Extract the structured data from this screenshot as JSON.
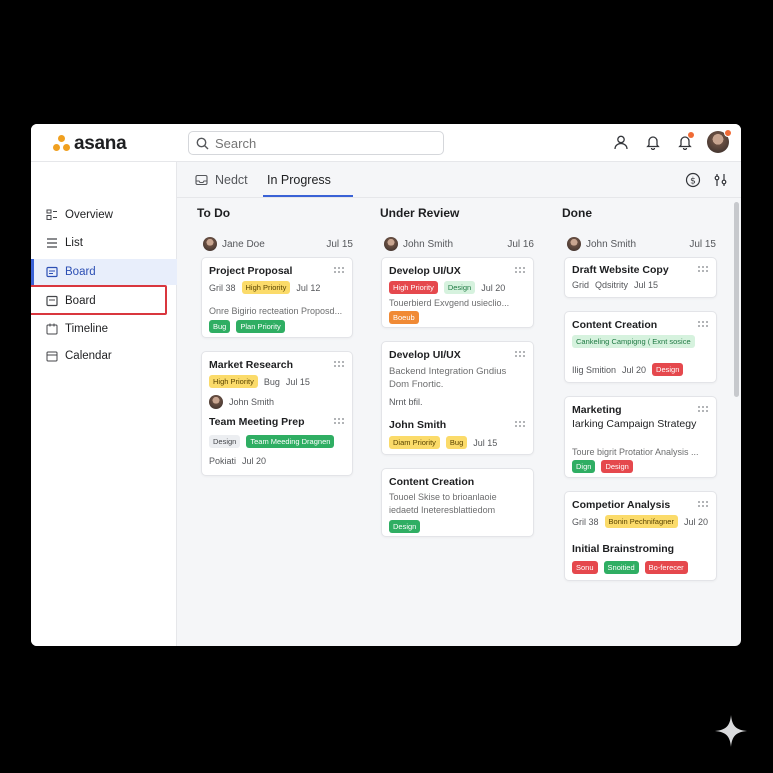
{
  "app": {
    "logo_text": "asana",
    "brand_color": "#f0a020",
    "accent_color": "#3a62d6"
  },
  "search": {
    "placeholder": "Search",
    "icon": "search-icon"
  },
  "topbar_icons": [
    "user-icon",
    "bell-icon",
    "bell-alert-icon",
    "avatar"
  ],
  "sidebar": {
    "items": [
      {
        "label": "Overview",
        "icon": "overview-icon"
      },
      {
        "label": "List",
        "icon": "list-icon"
      },
      {
        "label": "Board",
        "icon": "board-icon",
        "active": true
      },
      {
        "label": "Board",
        "icon": "board-icon",
        "highlighted": true
      },
      {
        "label": "Timeline",
        "icon": "timeline-icon"
      },
      {
        "label": "Calendar",
        "icon": "calendar-icon"
      }
    ]
  },
  "tabs": [
    {
      "label": "Nedct",
      "icon": "inbox-icon"
    },
    {
      "label": "In Progress",
      "active": true
    }
  ],
  "columns": [
    {
      "title": "To Do",
      "meta": {
        "name": "Jane Doe",
        "date": "Jul 15"
      },
      "cards": [
        {
          "title": "Project Proposal",
          "row1_text": "Gril 38",
          "row1_tag": "High Priority",
          "row1_date": "Jul 12",
          "desc": "Onre Bigirio recteation Proposd...",
          "tags": [
            "Bug",
            "Plan Priority"
          ]
        },
        {
          "title": "Market Research",
          "row1_tag": "High Priority",
          "row1_text": "Bug",
          "row1_date": "Jul 15",
          "person": "John Smith",
          "subtitle": "Team Meeting Prep",
          "tags": [
            "Design",
            "Team Meeding Dragnen"
          ],
          "foot_text": "Pokiati",
          "foot_date": "Jul 20"
        }
      ]
    },
    {
      "title": "Under Review",
      "meta": {
        "name": "John Smith",
        "date": "Jul 16"
      },
      "cards": [
        {
          "title": "Develop UI/UX",
          "row1_tag": "High Priority",
          "row1_tag2": "Design",
          "row1_date": "Jul 20",
          "desc": "Touerbierd Exvgend usieclio...",
          "tags": [
            "Boeub"
          ]
        },
        {
          "title": "Develop UI/UX",
          "desc1": "Backend Integration Gndius",
          "desc2": "Dom Fnortic.",
          "row_text": "Nrnt bfil.",
          "subtitle": "John Smith",
          "row2_tag": "Diam Priority",
          "row2_tag2": "Bug",
          "row2_date": "Jul 15"
        },
        {
          "title": "Content Creation",
          "desc1": "Touoel Skise to brioanlaoie",
          "desc2": "iedaetd Ineteresblattiedom",
          "tags": [
            "Design"
          ]
        }
      ]
    },
    {
      "title": "Done",
      "meta": {
        "name": "John Smith",
        "date": "Jul 15"
      },
      "cards": [
        {
          "title": "Draft Website Copy",
          "row1_text": "Grid",
          "row1_text2": "Qdsitrity",
          "row1_date": "Jul 15"
        },
        {
          "title": "Content Creation",
          "tag_wide": "Cankeling Campigng ( Exnt sosice",
          "row_text": "Ilig Smition",
          "row_date": "Jul 20",
          "row_tag": "Design"
        },
        {
          "title": "Marketing",
          "title2": "Iarking Campaign Strategy",
          "desc": "Toure bigrit Protatior Analysis ...",
          "tags": [
            "Dign",
            "Design"
          ]
        },
        {
          "title": "Competior Analysis",
          "row1_text": "Gril 38",
          "row1_tag": "Bonin Pechnifagner",
          "row1_date": "Jul 20",
          "subtitle": "Initial Brainstroming",
          "tags": [
            "Sonu",
            "Snoitied",
            "Bo-ferecer"
          ]
        }
      ]
    }
  ]
}
